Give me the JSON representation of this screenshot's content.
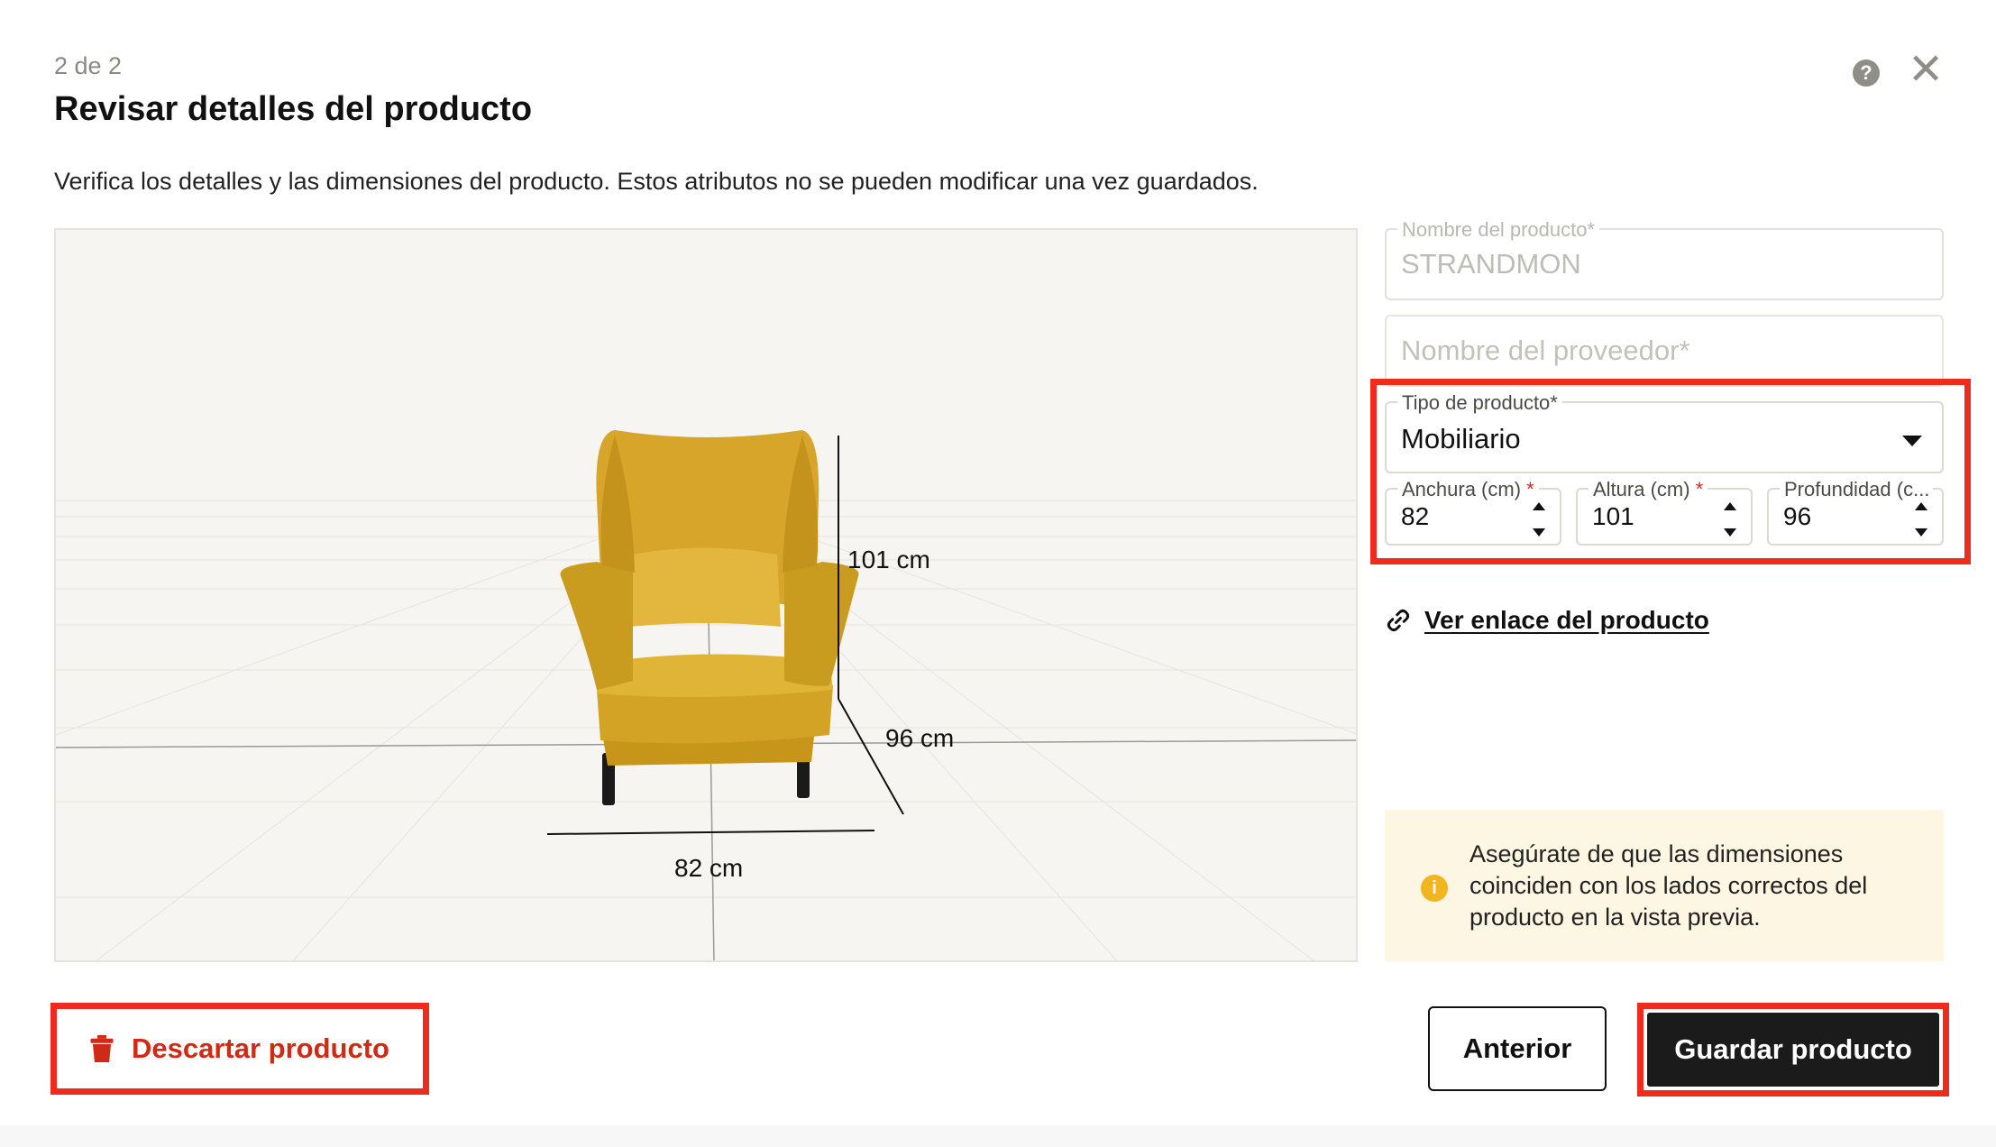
{
  "header": {
    "step": "2 de 2",
    "title": "Revisar detalles del producto",
    "description": "Verifica los detalles y las dimensiones del producto. Estos atributos no se pueden modificar una vez guardados.",
    "help_icon": "?",
    "close_icon": "✕"
  },
  "preview": {
    "width_label": "82 cm",
    "height_label": "101 cm",
    "depth_label": "96 cm",
    "chair_color": "#d7a928"
  },
  "form": {
    "product_name": {
      "label": "Nombre del producto*",
      "value": "STRANDMON"
    },
    "supplier_name": {
      "placeholder": "Nombre del proveedor*"
    },
    "product_type": {
      "label": "Tipo de producto*",
      "value": "Mobiliario"
    },
    "width": {
      "label": "Anchura (cm)",
      "required_mark": "*",
      "value": "82"
    },
    "height": {
      "label": "Altura (cm)",
      "required_mark": "*",
      "value": "101"
    },
    "depth": {
      "label": "Profundidad (c...",
      "value": "96"
    }
  },
  "link": {
    "text": "Ver enlace del producto",
    "icon": "link-icon"
  },
  "notice": {
    "icon": "info-icon",
    "text": "Asegúrate de que las dimensiones coinciden con los lados correctos del producto en la vista previa."
  },
  "footer": {
    "discard_label": "Descartar producto",
    "previous_label": "Anterior",
    "save_label": "Guardar producto"
  },
  "colors": {
    "highlight": "#ef2b1b",
    "discard_text": "#cf2a16",
    "save_bg": "#1b1b1b",
    "notice_bg": "#fdf6e3",
    "info_icon": "#f2b51f"
  }
}
